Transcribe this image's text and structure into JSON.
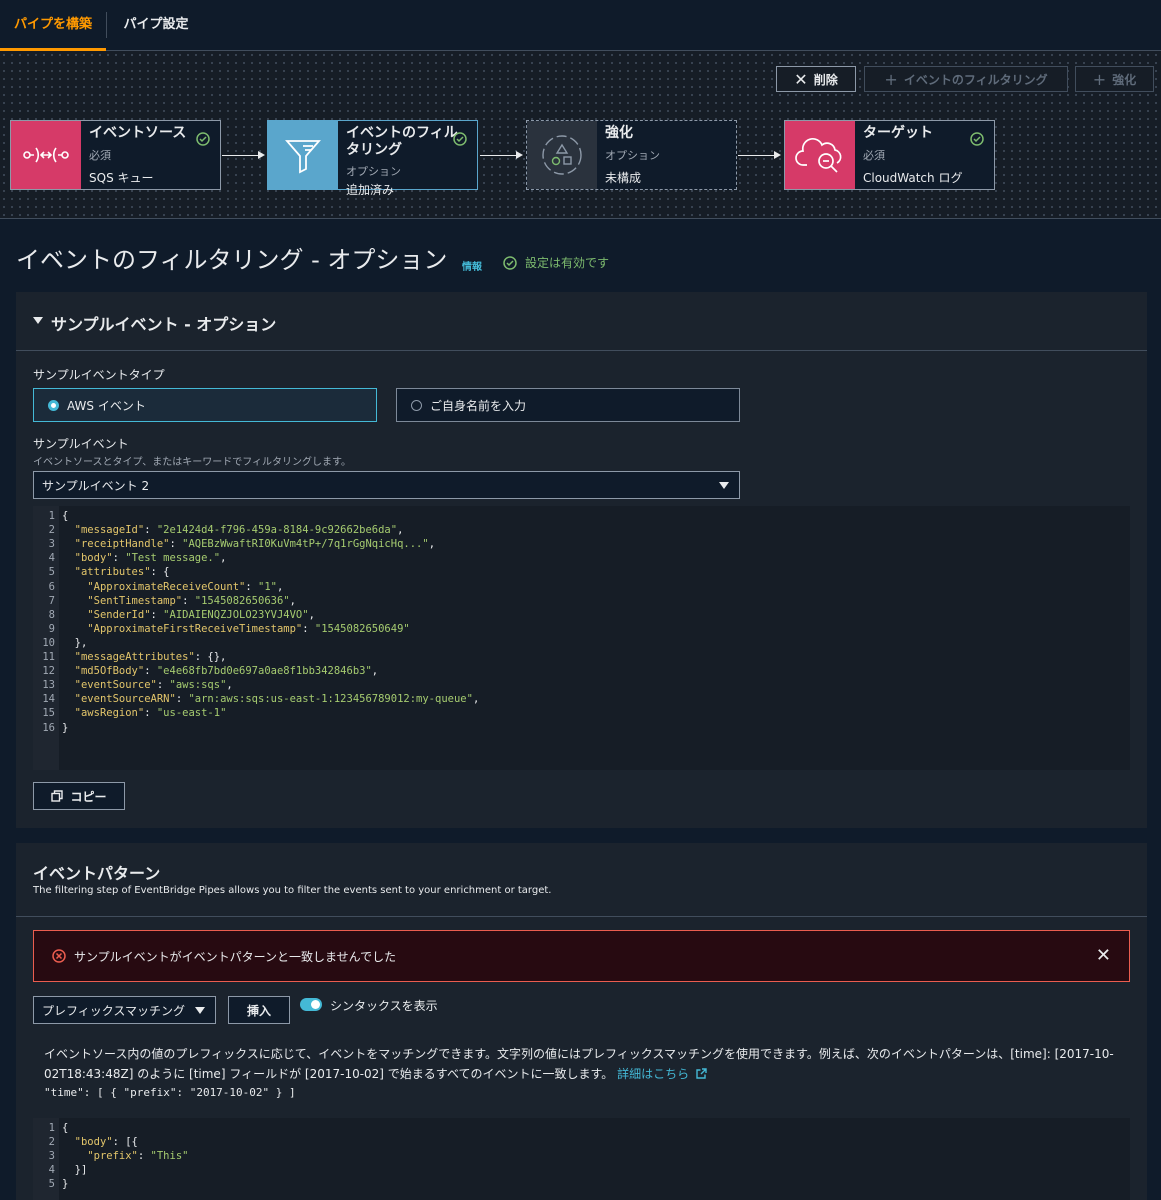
{
  "tabs": {
    "build": "パイプを構築",
    "settings": "パイプ設定"
  },
  "toolbar": {
    "delete": "削除",
    "filter": "イベントのフィルタリング",
    "enrich": "強化"
  },
  "nodes": {
    "source": {
      "title": "イベントソース",
      "req": "必須",
      "value": "SQS キュー"
    },
    "filter": {
      "title": "イベントのフィルタリング",
      "opt": "オプション",
      "value": "追加済み"
    },
    "enrich": {
      "title": "強化",
      "opt": "オプション",
      "value": "未構成"
    },
    "target": {
      "title": "ターゲット",
      "req": "必須",
      "value": "CloudWatch ログ"
    }
  },
  "heading": {
    "title": "イベントのフィルタリング - オプション",
    "info": "情報",
    "valid": "設定は有効です"
  },
  "sample": {
    "section_title": "サンプルイベント - オプション",
    "type_label": "サンプルイベントタイプ",
    "radio_aws": "AWS イベント",
    "radio_custom": "ご自身名前を入力",
    "event_label": "サンプルイベント",
    "event_desc": "イベントソースとタイプ、またはキーワードでフィルタリングします。",
    "selected": "サンプルイベント 2",
    "copy": "コピー"
  },
  "code1": [
    {
      "n": "1",
      "i": 0,
      "p": [
        [
          "t",
          "{"
        ]
      ]
    },
    {
      "n": "2",
      "i": 1,
      "p": [
        [
          "k",
          "\"messageId\""
        ],
        [
          "t",
          ": "
        ],
        [
          "s",
          "\"2e1424d4-f796-459a-8184-9c92662be6da\""
        ],
        [
          "t",
          ","
        ]
      ]
    },
    {
      "n": "3",
      "i": 1,
      "p": [
        [
          "k",
          "\"receiptHandle\""
        ],
        [
          "t",
          ": "
        ],
        [
          "s",
          "\"AQEBzWwaftRI0KuVm4tP+/7q1rGgNqicHq...\""
        ],
        [
          "t",
          ","
        ]
      ]
    },
    {
      "n": "4",
      "i": 1,
      "p": [
        [
          "k",
          "\"body\""
        ],
        [
          "t",
          ": "
        ],
        [
          "s",
          "\"Test message.\""
        ],
        [
          "t",
          ","
        ]
      ]
    },
    {
      "n": "5",
      "i": 1,
      "p": [
        [
          "k",
          "\"attributes\""
        ],
        [
          "t",
          ": {"
        ]
      ]
    },
    {
      "n": "6",
      "i": 2,
      "p": [
        [
          "k",
          "\"ApproximateReceiveCount\""
        ],
        [
          "t",
          ": "
        ],
        [
          "s",
          "\"1\""
        ],
        [
          "t",
          ","
        ]
      ]
    },
    {
      "n": "7",
      "i": 2,
      "p": [
        [
          "k",
          "\"SentTimestamp\""
        ],
        [
          "t",
          ": "
        ],
        [
          "s",
          "\"1545082650636\""
        ],
        [
          "t",
          ","
        ]
      ]
    },
    {
      "n": "8",
      "i": 2,
      "p": [
        [
          "k",
          "\"SenderId\""
        ],
        [
          "t",
          ": "
        ],
        [
          "s",
          "\"AIDAIENQZJOLO23YVJ4VO\""
        ],
        [
          "t",
          ","
        ]
      ]
    },
    {
      "n": "9",
      "i": 2,
      "p": [
        [
          "k",
          "\"ApproximateFirstReceiveTimestamp\""
        ],
        [
          "t",
          ": "
        ],
        [
          "s",
          "\"1545082650649\""
        ]
      ]
    },
    {
      "n": "10",
      "i": 1,
      "p": [
        [
          "t",
          "},"
        ]
      ]
    },
    {
      "n": "11",
      "i": 1,
      "p": [
        [
          "k",
          "\"messageAttributes\""
        ],
        [
          "t",
          ": {},"
        ]
      ]
    },
    {
      "n": "12",
      "i": 1,
      "p": [
        [
          "k",
          "\"md5OfBody\""
        ],
        [
          "t",
          ": "
        ],
        [
          "s",
          "\"e4e68fb7bd0e697a0ae8f1bb342846b3\""
        ],
        [
          "t",
          ","
        ]
      ]
    },
    {
      "n": "13",
      "i": 1,
      "p": [
        [
          "k",
          "\"eventSource\""
        ],
        [
          "t",
          ": "
        ],
        [
          "s",
          "\"aws:sqs\""
        ],
        [
          "t",
          ","
        ]
      ]
    },
    {
      "n": "14",
      "i": 1,
      "p": [
        [
          "k",
          "\"eventSourceARN\""
        ],
        [
          "t",
          ": "
        ],
        [
          "s",
          "\"arn:aws:sqs:us-east-1:123456789012:my-queue\""
        ],
        [
          "t",
          ","
        ]
      ]
    },
    {
      "n": "15",
      "i": 1,
      "p": [
        [
          "k",
          "\"awsRegion\""
        ],
        [
          "t",
          ": "
        ],
        [
          "s",
          "\"us-east-1\""
        ]
      ]
    },
    {
      "n": "16",
      "i": 0,
      "p": [
        [
          "t",
          "}"
        ]
      ]
    }
  ],
  "pattern": {
    "title": "イベントパターン",
    "desc": "The filtering step of EventBridge Pipes allows you to filter the events sent to your enrichment or target.",
    "alert": "サンプルイベントがイベントパターンと一致しませんでした",
    "match_select": "プレフィックスマッチング",
    "insert": "挿入",
    "syntax_toggle": "シンタックスを表示",
    "help": "イベントソース内の値のプレフィックスに応じて、イベントをマッチングできます。文字列の値にはプレフィックスマッチングを使用できます。例えば、次のイベントパターンは、[time]: [2017-10-02T18:43:48Z] のように [time] フィールドが [2017-10-02] で始まるすべてのイベントに一致します。",
    "help_link": "詳細はこちら",
    "example": "\"time\": [ { \"prefix\": \"2017-10-02\" } ]"
  },
  "code2": [
    {
      "n": "1",
      "i": 0,
      "p": [
        [
          "t",
          "{"
        ]
      ]
    },
    {
      "n": "2",
      "i": 1,
      "p": [
        [
          "k",
          "\"body\""
        ],
        [
          "t",
          ": [{"
        ]
      ]
    },
    {
      "n": "3",
      "i": 2,
      "p": [
        [
          "k",
          "\"prefix\""
        ],
        [
          "t",
          ": "
        ],
        [
          "s",
          "\"This\""
        ]
      ]
    },
    {
      "n": "4",
      "i": 1,
      "p": [
        [
          "t",
          "}]"
        ]
      ]
    },
    {
      "n": "5",
      "i": 0,
      "p": [
        [
          "t",
          "}"
        ]
      ]
    }
  ],
  "colors": {
    "accent": "#ff9900",
    "link": "#44b9d6",
    "success": "#7dbb6e",
    "error": "#eb5d4f",
    "source": "#d63a68",
    "filter": "#5aa6cc"
  }
}
